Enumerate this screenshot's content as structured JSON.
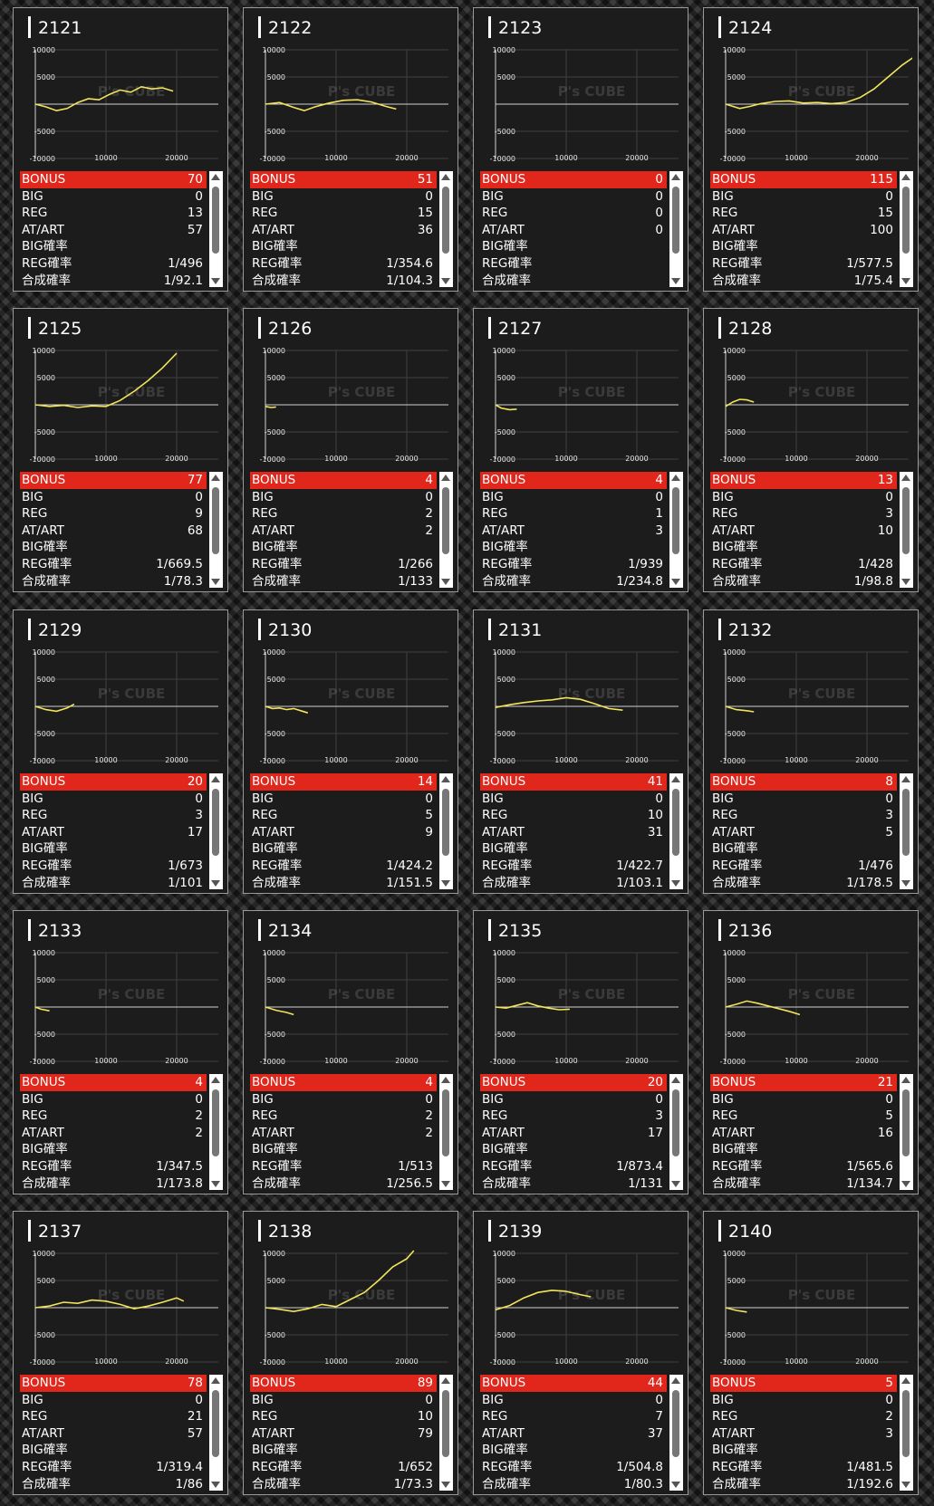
{
  "labels": {
    "bonus": "BONUS",
    "big": "BIG",
    "reg": "REG",
    "at_art": "AT/ART",
    "big_rate": "BIG確率",
    "reg_rate": "REG確率",
    "combined_rate": "合成確率"
  },
  "axis": {
    "y_ticks": [
      "10000",
      "5000",
      "-5000",
      "-10000"
    ],
    "x_ticks": [
      "10000",
      "20000"
    ]
  },
  "watermark": "P's CUBE",
  "colors": {
    "bonus_bar": "#e1261c",
    "line": "#f3e45b",
    "card_bg": "#1c1c1c"
  },
  "machines": [
    {
      "id": "2121",
      "bonus": "70",
      "big": "0",
      "reg": "13",
      "at_art": "57",
      "big_rate": "",
      "reg_rate": "1/496",
      "combined_rate": "1/92.1",
      "line": [
        [
          0,
          0
        ],
        [
          1500,
          -500
        ],
        [
          3000,
          -1200
        ],
        [
          4500,
          -800
        ],
        [
          6000,
          300
        ],
        [
          7500,
          1000
        ],
        [
          9000,
          800
        ],
        [
          10500,
          1800
        ],
        [
          12000,
          2600
        ],
        [
          13500,
          2200
        ],
        [
          15000,
          3200
        ],
        [
          16500,
          2800
        ],
        [
          18000,
          3000
        ],
        [
          19500,
          2400
        ]
      ]
    },
    {
      "id": "2122",
      "bonus": "51",
      "big": "0",
      "reg": "15",
      "at_art": "36",
      "big_rate": "",
      "reg_rate": "1/354.6",
      "combined_rate": "1/104.3",
      "line": [
        [
          0,
          0
        ],
        [
          2000,
          300
        ],
        [
          4000,
          -600
        ],
        [
          5500,
          -1200
        ],
        [
          7000,
          -500
        ],
        [
          9000,
          200
        ],
        [
          11000,
          700
        ],
        [
          13000,
          800
        ],
        [
          15000,
          400
        ],
        [
          17000,
          -400
        ],
        [
          18500,
          -900
        ]
      ]
    },
    {
      "id": "2123",
      "bonus": "0",
      "big": "0",
      "reg": "0",
      "at_art": "0",
      "big_rate": "",
      "reg_rate": "",
      "combined_rate": "",
      "line": []
    },
    {
      "id": "2124",
      "bonus": "115",
      "big": "0",
      "reg": "15",
      "at_art": "100",
      "big_rate": "",
      "reg_rate": "1/577.5",
      "combined_rate": "1/75.4",
      "line": [
        [
          0,
          0
        ],
        [
          2000,
          -800
        ],
        [
          3500,
          -400
        ],
        [
          5000,
          100
        ],
        [
          7000,
          500
        ],
        [
          9000,
          600
        ],
        [
          11000,
          200
        ],
        [
          13000,
          300
        ],
        [
          15000,
          100
        ],
        [
          17000,
          300
        ],
        [
          19000,
          1200
        ],
        [
          21000,
          2800
        ],
        [
          23000,
          5000
        ],
        [
          25000,
          7200
        ],
        [
          27000,
          9000
        ],
        [
          29000,
          9800
        ],
        [
          30500,
          10300
        ]
      ]
    },
    {
      "id": "2125",
      "bonus": "77",
      "big": "0",
      "reg": "9",
      "at_art": "68",
      "big_rate": "",
      "reg_rate": "1/669.5",
      "combined_rate": "1/78.3",
      "line": [
        [
          0,
          0
        ],
        [
          2000,
          -300
        ],
        [
          4000,
          -100
        ],
        [
          6000,
          -500
        ],
        [
          8000,
          -200
        ],
        [
          10000,
          -300
        ],
        [
          12000,
          800
        ],
        [
          14000,
          2500
        ],
        [
          16000,
          4500
        ],
        [
          18000,
          6800
        ],
        [
          20000,
          9500
        ]
      ]
    },
    {
      "id": "2126",
      "bonus": "4",
      "big": "0",
      "reg": "2",
      "at_art": "2",
      "big_rate": "",
      "reg_rate": "1/266",
      "combined_rate": "1/133",
      "line": [
        [
          0,
          -300
        ],
        [
          800,
          -500
        ],
        [
          1500,
          -400
        ]
      ]
    },
    {
      "id": "2127",
      "bonus": "4",
      "big": "0",
      "reg": "1",
      "at_art": "3",
      "big_rate": "",
      "reg_rate": "1/939",
      "combined_rate": "1/234.8",
      "line": [
        [
          0,
          0
        ],
        [
          800,
          -600
        ],
        [
          2000,
          -900
        ],
        [
          3000,
          -800
        ]
      ]
    },
    {
      "id": "2128",
      "bonus": "13",
      "big": "0",
      "reg": "3",
      "at_art": "10",
      "big_rate": "",
      "reg_rate": "1/428",
      "combined_rate": "1/98.8",
      "line": [
        [
          0,
          -300
        ],
        [
          1000,
          500
        ],
        [
          2000,
          1000
        ],
        [
          3000,
          900
        ],
        [
          4000,
          500
        ]
      ]
    },
    {
      "id": "2129",
      "bonus": "20",
      "big": "0",
      "reg": "3",
      "at_art": "17",
      "big_rate": "",
      "reg_rate": "1/673",
      "combined_rate": "1/101",
      "line": [
        [
          0,
          0
        ],
        [
          1500,
          -600
        ],
        [
          3000,
          -900
        ],
        [
          4500,
          -300
        ],
        [
          5500,
          400
        ]
      ]
    },
    {
      "id": "2130",
      "bonus": "14",
      "big": "0",
      "reg": "5",
      "at_art": "9",
      "big_rate": "",
      "reg_rate": "1/424.2",
      "combined_rate": "1/151.5",
      "line": [
        [
          0,
          0
        ],
        [
          1000,
          -400
        ],
        [
          2000,
          -300
        ],
        [
          3000,
          -600
        ],
        [
          4000,
          -400
        ],
        [
          5000,
          -800
        ],
        [
          6000,
          -1200
        ]
      ]
    },
    {
      "id": "2131",
      "bonus": "41",
      "big": "0",
      "reg": "10",
      "at_art": "31",
      "big_rate": "",
      "reg_rate": "1/422.7",
      "combined_rate": "1/103.1",
      "line": [
        [
          0,
          -200
        ],
        [
          2000,
          300
        ],
        [
          4000,
          700
        ],
        [
          6000,
          1000
        ],
        [
          8000,
          1200
        ],
        [
          10000,
          1600
        ],
        [
          12000,
          1300
        ],
        [
          14000,
          500
        ],
        [
          16000,
          -400
        ],
        [
          18000,
          -700
        ]
      ]
    },
    {
      "id": "2132",
      "bonus": "8",
      "big": "0",
      "reg": "3",
      "at_art": "5",
      "big_rate": "",
      "reg_rate": "1/476",
      "combined_rate": "1/178.5",
      "line": [
        [
          0,
          0
        ],
        [
          1500,
          -600
        ],
        [
          3000,
          -800
        ],
        [
          4000,
          -1000
        ]
      ]
    },
    {
      "id": "2133",
      "bonus": "4",
      "big": "0",
      "reg": "2",
      "at_art": "2",
      "big_rate": "",
      "reg_rate": "1/347.5",
      "combined_rate": "1/173.8",
      "line": [
        [
          0,
          0
        ],
        [
          800,
          -400
        ],
        [
          2000,
          -700
        ]
      ]
    },
    {
      "id": "2134",
      "bonus": "4",
      "big": "0",
      "reg": "2",
      "at_art": "2",
      "big_rate": "",
      "reg_rate": "1/513",
      "combined_rate": "1/256.5",
      "line": [
        [
          0,
          0
        ],
        [
          1500,
          -600
        ],
        [
          3000,
          -1000
        ],
        [
          4000,
          -1400
        ]
      ]
    },
    {
      "id": "2135",
      "bonus": "20",
      "big": "0",
      "reg": "3",
      "at_art": "17",
      "big_rate": "",
      "reg_rate": "1/873.4",
      "combined_rate": "1/131",
      "line": [
        [
          0,
          0
        ],
        [
          1500,
          -200
        ],
        [
          3000,
          300
        ],
        [
          4500,
          800
        ],
        [
          6000,
          200
        ],
        [
          7500,
          -200
        ],
        [
          9000,
          -500
        ],
        [
          10500,
          -400
        ]
      ]
    },
    {
      "id": "2136",
      "bonus": "21",
      "big": "0",
      "reg": "5",
      "at_art": "16",
      "big_rate": "",
      "reg_rate": "1/565.6",
      "combined_rate": "1/134.7",
      "line": [
        [
          0,
          0
        ],
        [
          1500,
          500
        ],
        [
          3000,
          1100
        ],
        [
          4500,
          700
        ],
        [
          6000,
          200
        ],
        [
          7500,
          -300
        ],
        [
          9000,
          -800
        ],
        [
          10500,
          -1400
        ]
      ]
    },
    {
      "id": "2137",
      "bonus": "78",
      "big": "0",
      "reg": "21",
      "at_art": "57",
      "big_rate": "",
      "reg_rate": "1/319.4",
      "combined_rate": "1/86",
      "line": [
        [
          0,
          0
        ],
        [
          2000,
          300
        ],
        [
          4000,
          1000
        ],
        [
          6000,
          800
        ],
        [
          8000,
          1400
        ],
        [
          10000,
          1200
        ],
        [
          12000,
          600
        ],
        [
          14000,
          -200
        ],
        [
          16000,
          300
        ],
        [
          18000,
          1000
        ],
        [
          20000,
          1800
        ],
        [
          21000,
          1200
        ]
      ]
    },
    {
      "id": "2138",
      "bonus": "89",
      "big": "0",
      "reg": "10",
      "at_art": "79",
      "big_rate": "",
      "reg_rate": "1/652",
      "combined_rate": "1/73.3",
      "line": [
        [
          0,
          0
        ],
        [
          2000,
          -300
        ],
        [
          4000,
          -700
        ],
        [
          6000,
          -200
        ],
        [
          8000,
          600
        ],
        [
          10000,
          200
        ],
        [
          12000,
          1500
        ],
        [
          14000,
          2800
        ],
        [
          16000,
          5000
        ],
        [
          18000,
          7500
        ],
        [
          20000,
          9000
        ],
        [
          21000,
          10500
        ]
      ]
    },
    {
      "id": "2139",
      "bonus": "44",
      "big": "0",
      "reg": "7",
      "at_art": "37",
      "big_rate": "",
      "reg_rate": "1/504.8",
      "combined_rate": "1/80.3",
      "line": [
        [
          0,
          -400
        ],
        [
          2000,
          400
        ],
        [
          4000,
          1800
        ],
        [
          6000,
          2800
        ],
        [
          8000,
          3200
        ],
        [
          10000,
          3000
        ],
        [
          12000,
          2400
        ],
        [
          13500,
          2000
        ]
      ]
    },
    {
      "id": "2140",
      "bonus": "5",
      "big": "0",
      "reg": "2",
      "at_art": "3",
      "big_rate": "",
      "reg_rate": "1/481.5",
      "combined_rate": "1/192.6",
      "line": [
        [
          0,
          0
        ],
        [
          1500,
          -500
        ],
        [
          3000,
          -800
        ]
      ]
    }
  ]
}
